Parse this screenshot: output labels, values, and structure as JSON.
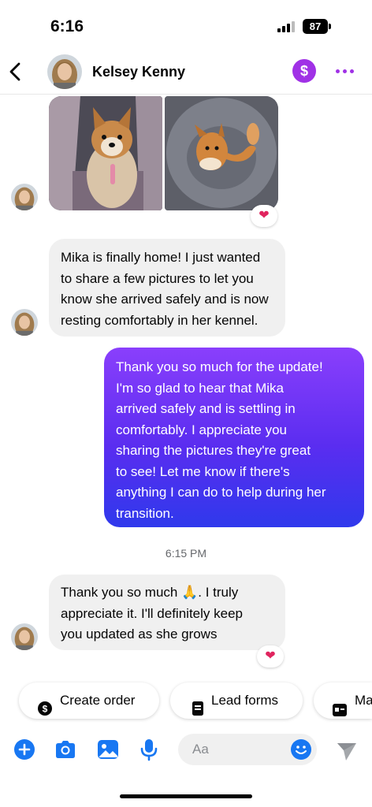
{
  "status_bar": {
    "time": "6:16",
    "battery": "87"
  },
  "header": {
    "contact_name": "Kelsey Kenny",
    "dollar_symbol": "$",
    "icons": [
      "chevron-left-icon",
      "avatar",
      "dollar-icon",
      "more-icon"
    ]
  },
  "conversation": {
    "photo_reaction": "❤",
    "message_1": "Mika is finally home! I just wanted\nto share a few pictures to let you\nknow she arrived safely and is now\nresting comfortably in her kennel.",
    "reply": "Thank you so much for the update!\nI'm so glad to hear that Mika\narrived safely and is settling in\ncomfortably. I appreciate you\nsharing the pictures they're great\nto see! Let me know if there's\nanything I can do to help during her\ntransition.",
    "timestamp": "6:15 PM",
    "message_2_line1": "Thank you so much",
    "message_2_emoji": "🙏",
    "message_2_line1_end": ". I truly",
    "message_2_rest": "appreciate it. I'll definitely keep\nyou updated as she grows",
    "message_2_reaction": "❤"
  },
  "quick_replies": [
    {
      "label": "Create order",
      "icon": "dollar-circle-icon"
    },
    {
      "label": "Lead forms",
      "icon": "form-icon"
    },
    {
      "label": "Ma",
      "icon": "card-icon"
    }
  ],
  "composer": {
    "placeholder": "Aa",
    "icons": [
      "plus-icon",
      "camera-icon",
      "gallery-icon",
      "microphone-icon",
      "emoji-icon",
      "send-icon"
    ]
  },
  "colors": {
    "accent": "#a031e6",
    "link_blue": "#1877f2",
    "bubble_out_top": "#8a3ffc",
    "bubble_out_bottom": "#2f39ec",
    "bubble_in": "#f0f0f0"
  }
}
